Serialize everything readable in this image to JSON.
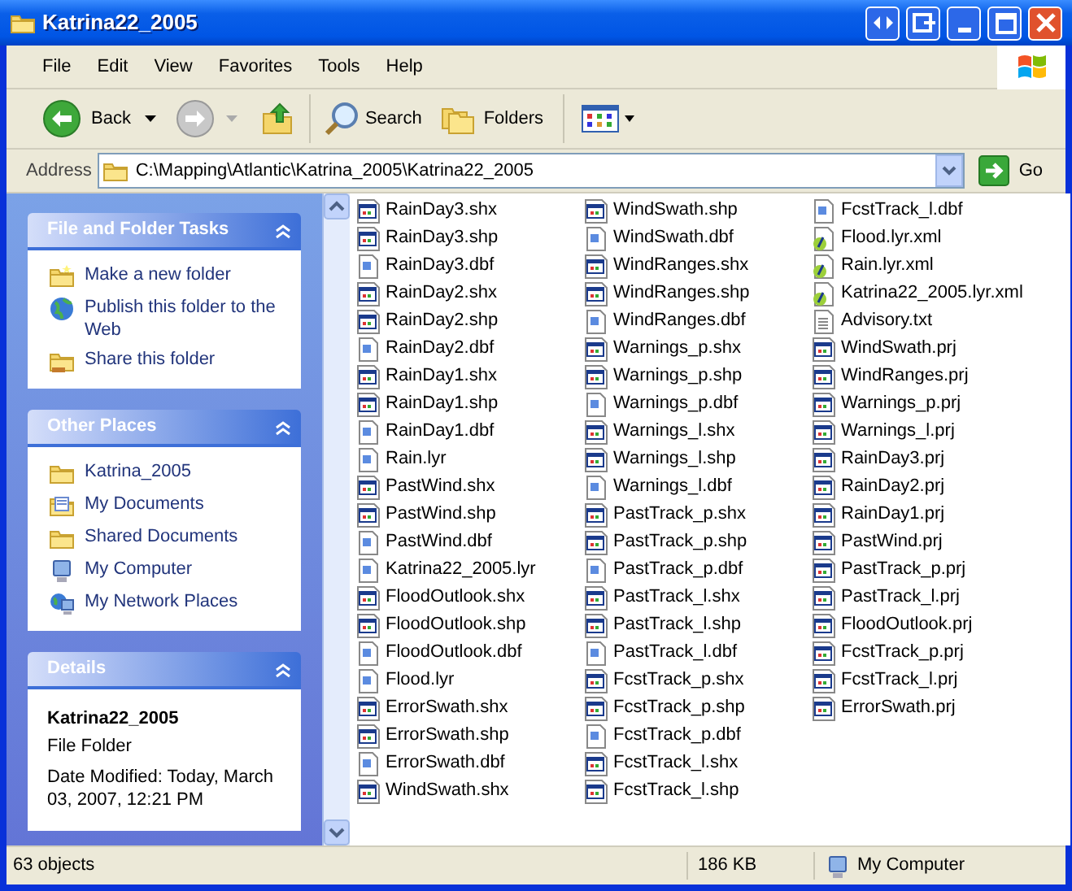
{
  "window": {
    "title": "Katrina22_2005"
  },
  "menu": [
    "File",
    "Edit",
    "View",
    "Favorites",
    "Tools",
    "Help"
  ],
  "toolbar": {
    "back": "Back",
    "search": "Search",
    "folders": "Folders"
  },
  "address": {
    "label": "Address",
    "value": "C:\\Mapping\\Atlantic\\Katrina_2005\\Katrina22_2005",
    "go": "Go"
  },
  "sidebar": [
    {
      "title": "File and Folder Tasks",
      "items": [
        {
          "label": "Make a new folder",
          "kind": "newfolder"
        },
        {
          "label": "Publish this folder to the Web",
          "kind": "globe"
        },
        {
          "label": "Share this folder",
          "kind": "share"
        }
      ]
    },
    {
      "title": "Other Places",
      "items": [
        {
          "label": "Katrina_2005",
          "kind": "folder"
        },
        {
          "label": "My Documents",
          "kind": "docs"
        },
        {
          "label": "Shared Documents",
          "kind": "folder"
        },
        {
          "label": "My Computer",
          "kind": "computer"
        },
        {
          "label": "My Network Places",
          "kind": "network"
        }
      ]
    },
    {
      "title": "Details",
      "name": "Katrina22_2005",
      "type": "File Folder",
      "modified": "Date Modified: Today, March 03, 2007, 12:21 PM"
    }
  ],
  "files": [
    {
      "name": "RainDay3.shx",
      "kind": "map"
    },
    {
      "name": "RainDay3.shp",
      "kind": "map"
    },
    {
      "name": "RainDay3.dbf",
      "kind": "data"
    },
    {
      "name": "RainDay2.shx",
      "kind": "map"
    },
    {
      "name": "RainDay2.shp",
      "kind": "map"
    },
    {
      "name": "RainDay2.dbf",
      "kind": "data"
    },
    {
      "name": "RainDay1.shx",
      "kind": "map"
    },
    {
      "name": "RainDay1.shp",
      "kind": "map"
    },
    {
      "name": "RainDay1.dbf",
      "kind": "data"
    },
    {
      "name": "Rain.lyr",
      "kind": "data"
    },
    {
      "name": "PastWind.shx",
      "kind": "map"
    },
    {
      "name": "PastWind.shp",
      "kind": "map"
    },
    {
      "name": "PastWind.dbf",
      "kind": "data"
    },
    {
      "name": "Katrina22_2005.lyr",
      "kind": "data"
    },
    {
      "name": "FloodOutlook.shx",
      "kind": "map"
    },
    {
      "name": "FloodOutlook.shp",
      "kind": "map"
    },
    {
      "name": "FloodOutlook.dbf",
      "kind": "data"
    },
    {
      "name": "Flood.lyr",
      "kind": "data"
    },
    {
      "name": "ErrorSwath.shx",
      "kind": "map"
    },
    {
      "name": "ErrorSwath.shp",
      "kind": "map"
    },
    {
      "name": "ErrorSwath.dbf",
      "kind": "data"
    },
    {
      "name": "WindSwath.shx",
      "kind": "map"
    },
    {
      "name": "WindSwath.shp",
      "kind": "map"
    },
    {
      "name": "WindSwath.dbf",
      "kind": "data"
    },
    {
      "name": "WindRanges.shx",
      "kind": "map"
    },
    {
      "name": "WindRanges.shp",
      "kind": "map"
    },
    {
      "name": "WindRanges.dbf",
      "kind": "data"
    },
    {
      "name": "Warnings_p.shx",
      "kind": "map"
    },
    {
      "name": "Warnings_p.shp",
      "kind": "map"
    },
    {
      "name": "Warnings_p.dbf",
      "kind": "data"
    },
    {
      "name": "Warnings_l.shx",
      "kind": "map"
    },
    {
      "name": "Warnings_l.shp",
      "kind": "map"
    },
    {
      "name": "Warnings_l.dbf",
      "kind": "data"
    },
    {
      "name": "PastTrack_p.shx",
      "kind": "map"
    },
    {
      "name": "PastTrack_p.shp",
      "kind": "map"
    },
    {
      "name": "PastTrack_p.dbf",
      "kind": "data"
    },
    {
      "name": "PastTrack_l.shx",
      "kind": "map"
    },
    {
      "name": "PastTrack_l.shp",
      "kind": "map"
    },
    {
      "name": "PastTrack_l.dbf",
      "kind": "data"
    },
    {
      "name": "FcstTrack_p.shx",
      "kind": "map"
    },
    {
      "name": "FcstTrack_p.shp",
      "kind": "map"
    },
    {
      "name": "FcstTrack_p.dbf",
      "kind": "data"
    },
    {
      "name": "FcstTrack_l.shx",
      "kind": "map"
    },
    {
      "name": "FcstTrack_l.shp",
      "kind": "map"
    },
    {
      "name": "FcstTrack_l.dbf",
      "kind": "data"
    },
    {
      "name": "Flood.lyr.xml",
      "kind": "xml"
    },
    {
      "name": "Rain.lyr.xml",
      "kind": "xml"
    },
    {
      "name": "Katrina22_2005.lyr.xml",
      "kind": "xml"
    },
    {
      "name": "Advisory.txt",
      "kind": "text"
    },
    {
      "name": "WindSwath.prj",
      "kind": "map"
    },
    {
      "name": "WindRanges.prj",
      "kind": "map"
    },
    {
      "name": "Warnings_p.prj",
      "kind": "map"
    },
    {
      "name": "Warnings_l.prj",
      "kind": "map"
    },
    {
      "name": "RainDay3.prj",
      "kind": "map"
    },
    {
      "name": "RainDay2.prj",
      "kind": "map"
    },
    {
      "name": "RainDay1.prj",
      "kind": "map"
    },
    {
      "name": "PastWind.prj",
      "kind": "map"
    },
    {
      "name": "PastTrack_p.prj",
      "kind": "map"
    },
    {
      "name": "PastTrack_l.prj",
      "kind": "map"
    },
    {
      "name": "FloodOutlook.prj",
      "kind": "map"
    },
    {
      "name": "FcstTrack_p.prj",
      "kind": "map"
    },
    {
      "name": "FcstTrack_l.prj",
      "kind": "map"
    },
    {
      "name": "ErrorSwath.prj",
      "kind": "map"
    }
  ],
  "status_bar": {
    "objects": "63 objects",
    "size": "186 KB",
    "location": "My Computer"
  }
}
